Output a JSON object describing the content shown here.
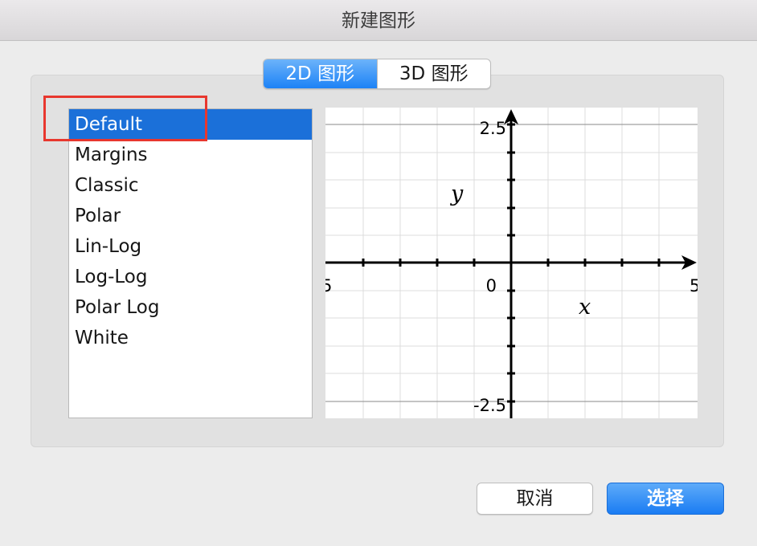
{
  "window": {
    "title": "新建图形"
  },
  "tabs": [
    {
      "label": "2D 图形",
      "active": true
    },
    {
      "label": "3D 图形",
      "active": false
    }
  ],
  "templates": {
    "items": [
      "Default",
      "Margins",
      "Classic",
      "Polar",
      "Lin-Log",
      "Log-Log",
      "Polar Log",
      "White"
    ],
    "selected": "Default"
  },
  "preview": {
    "y_top_label": "2.5",
    "y_bottom_label": "-2.5",
    "x_left_label": "5",
    "x_origin_label": "0",
    "x_right_label": "5",
    "x_axis_name": "x",
    "y_axis_name": "y"
  },
  "buttons": {
    "cancel": "取消",
    "ok": "选择"
  },
  "colors": {
    "accent": "#1c82f6",
    "selection": "#1b70d9",
    "annotation_box": "#e8372e"
  }
}
